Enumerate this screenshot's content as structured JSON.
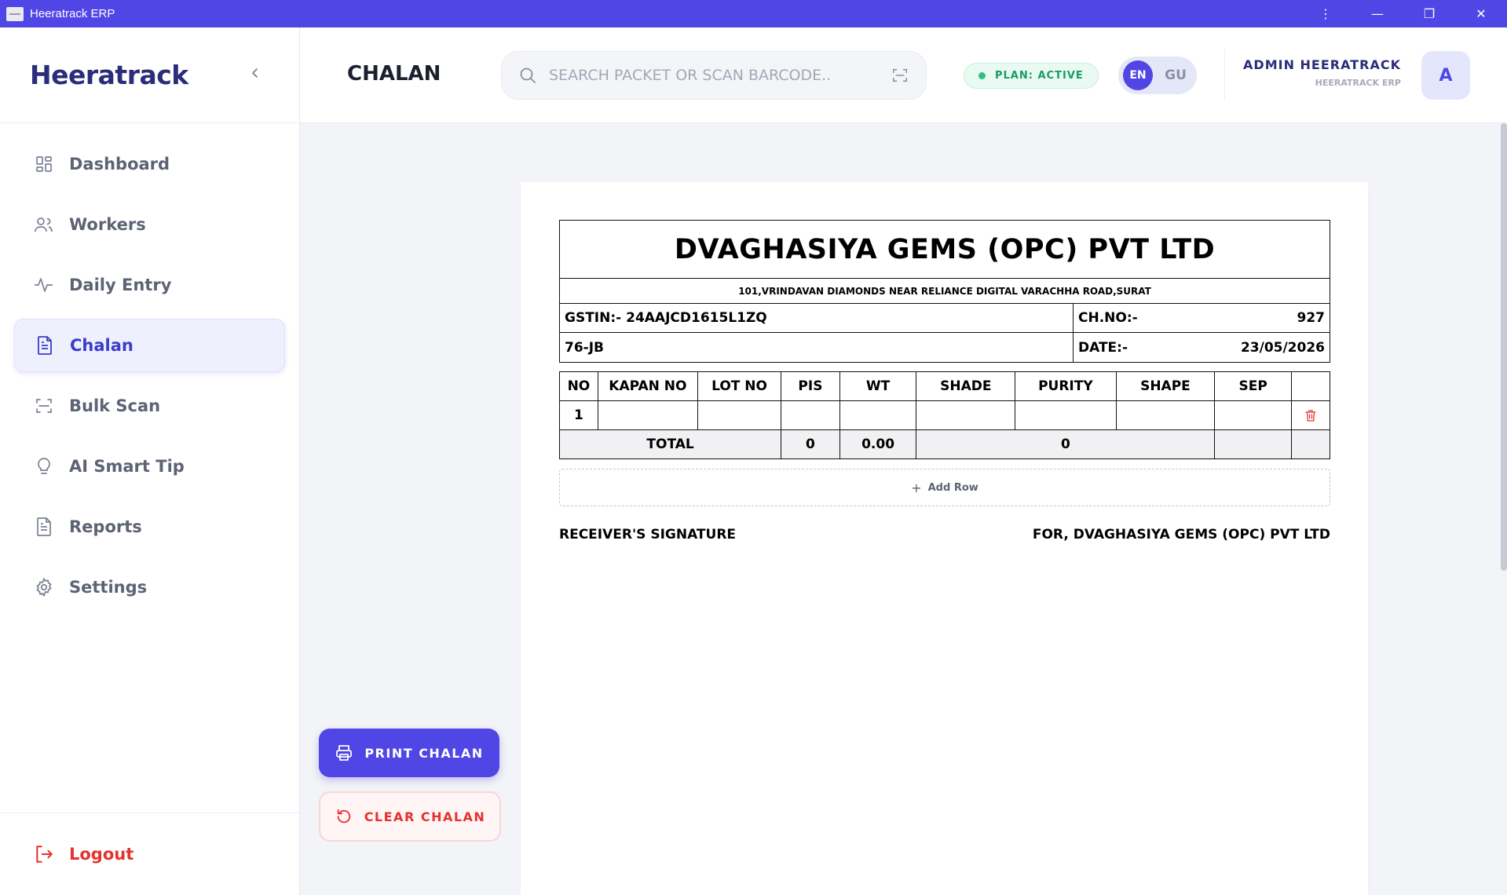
{
  "window": {
    "title": "Heeratrack ERP",
    "controls": [
      "⋮",
      "—",
      "❐",
      "✕"
    ]
  },
  "sidebar": {
    "brand": "Heeratrack",
    "collapse_icon": "chevron-left-icon",
    "items": [
      {
        "label": "Dashboard",
        "icon": "grid-icon",
        "active": false
      },
      {
        "label": "Workers",
        "icon": "users-icon",
        "active": false
      },
      {
        "label": "Daily Entry",
        "icon": "activity-icon",
        "active": false
      },
      {
        "label": "Chalan",
        "icon": "file-text-icon",
        "active": true
      },
      {
        "label": "Bulk Scan",
        "icon": "scan-icon",
        "active": false
      },
      {
        "label": "AI Smart Tip",
        "icon": "lightbulb-icon",
        "active": false
      },
      {
        "label": "Reports",
        "icon": "file-icon",
        "active": false
      },
      {
        "label": "Settings",
        "icon": "gear-icon",
        "active": false
      }
    ],
    "logout_label": "Logout"
  },
  "header": {
    "title": "CHALAN",
    "search_placeholder": "SEARCH PACKET OR SCAN BARCODE..",
    "plan_status": "PLAN: ACTIVE",
    "lang_active": "EN",
    "lang_inactive": "GU",
    "user_name": "ADMIN HEERATRACK",
    "user_sub": "HEERATRACK ERP",
    "avatar_letter": "A"
  },
  "actions": {
    "print_label": "PRINT CHALAN",
    "clear_label": "CLEAR CHALAN"
  },
  "chalan": {
    "company": "DVAGHASIYA GEMS (OPC) PVT LTD",
    "address": "101,VRINDAVAN DIAMONDS NEAR RELIANCE DIGITAL VARACHHA ROAD,SURAT",
    "gstin": "GSTIN:- 24AAJCD1615L1ZQ",
    "ch_no_label": "CH.NO:-",
    "ch_no_value": "927",
    "party": "76-JB",
    "date_label": "DATE:-",
    "date_value": "23/05/2026",
    "columns": [
      "NO",
      "KAPAN NO",
      "LOT NO",
      "PIS",
      "WT",
      "SHADE",
      "PURITY",
      "SHAPE",
      "SEP",
      ""
    ],
    "rows": [
      {
        "no": "1",
        "kapan_no": "",
        "lot_no": "",
        "pis": "",
        "wt": "",
        "shade": "",
        "purity": "",
        "shape": "",
        "sep": ""
      }
    ],
    "total_label": "TOTAL",
    "total_pis": "0",
    "total_wt": "0.00",
    "total_mid": "0",
    "add_row_label": "Add Row",
    "receiver_signature": "RECEIVER'S SIGNATURE",
    "for_company": "FOR, DVAGHASIYA GEMS (OPC) PVT LTD"
  },
  "colors": {
    "accent": "#4f46e5",
    "brand_text": "#2b2d7a",
    "danger": "#e5322e",
    "success": "#2ec27e"
  }
}
